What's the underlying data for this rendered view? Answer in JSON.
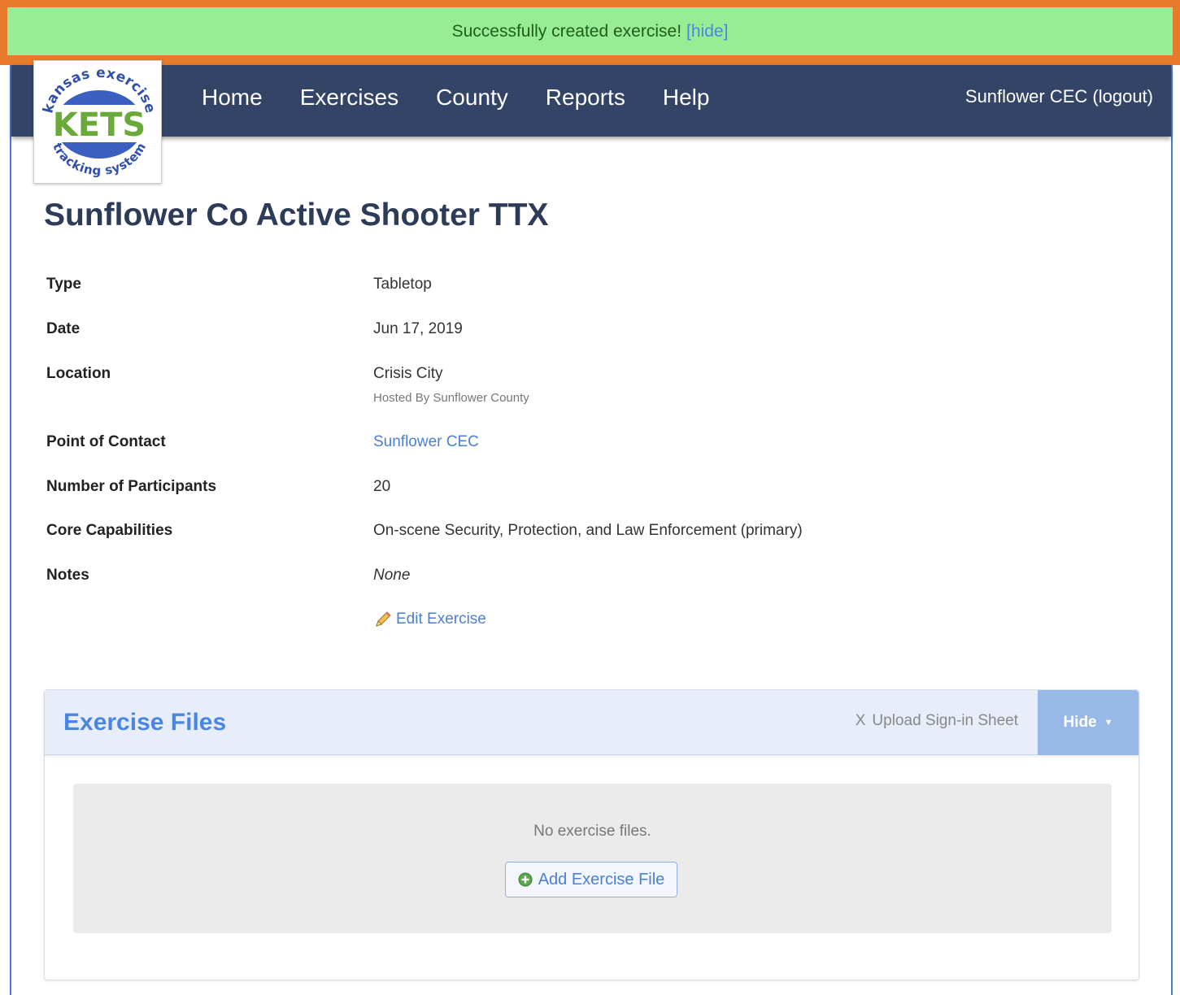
{
  "banner": {
    "message": "Successfully created exercise!",
    "hide_link": "[hide]"
  },
  "logo": {
    "top_arc": "kansas exercise",
    "center": "KETS",
    "bottom_arc": "tracking system"
  },
  "nav": {
    "items": [
      {
        "label": "Home"
      },
      {
        "label": "Exercises"
      },
      {
        "label": "County"
      },
      {
        "label": "Reports"
      },
      {
        "label": "Help"
      }
    ],
    "user": "Sunflower CEC (logout)"
  },
  "exercise": {
    "title": "Sunflower Co Active Shooter TTX",
    "fields": {
      "type": {
        "label": "Type",
        "value": "Tabletop"
      },
      "date": {
        "label": "Date",
        "value": "Jun 17, 2019"
      },
      "location": {
        "label": "Location",
        "value": "Crisis City",
        "sub": "Hosted By Sunflower County"
      },
      "poc": {
        "label": "Point of Contact",
        "value": "Sunflower CEC"
      },
      "participants": {
        "label": "Number of Participants",
        "value": "20"
      },
      "capabilities": {
        "label": "Core Capabilities",
        "value": "On-scene Security, Protection, and Law Enforcement (primary)"
      },
      "notes": {
        "label": "Notes",
        "value": "None"
      }
    },
    "edit_label": "Edit Exercise"
  },
  "files_panel": {
    "title": "Exercise Files",
    "upload_label": "Upload Sign-in Sheet",
    "upload_prefix": "X",
    "hide_label": "Hide",
    "empty_text": "No exercise files.",
    "add_label": "Add Exercise File"
  },
  "colors": {
    "navbar": "#334466",
    "banner": "#98ec93",
    "highlight": "#e87a2c",
    "link": "#4a7fd6"
  }
}
